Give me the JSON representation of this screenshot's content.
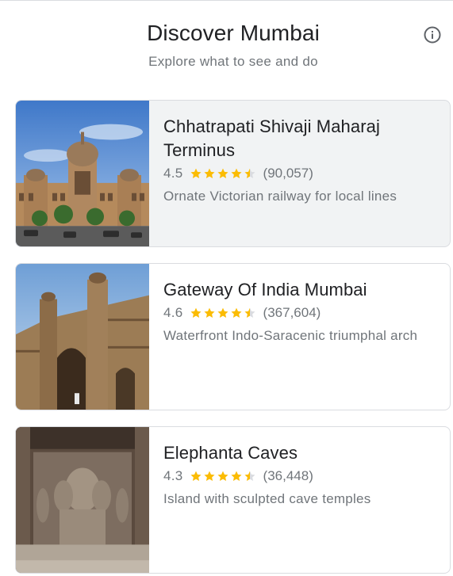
{
  "header": {
    "title": "Discover Mumbai",
    "subtitle": "Explore what to see and do",
    "info_icon": "info-icon"
  },
  "colors": {
    "star": "#fbbc04",
    "star_empty": "#dadce0",
    "text_primary": "#202124",
    "text_secondary": "#70757a",
    "card_border": "#dadce0",
    "card_highlight": "#f1f3f4"
  },
  "places": [
    {
      "name": "Chhatrapati Shivaji Maharaj Terminus",
      "rating": "4.5",
      "rating_value": 4.5,
      "reviews": "(90,057)",
      "description": "Ornate Victorian railway for local lines"
    },
    {
      "name": "Gateway Of India Mumbai",
      "rating": "4.6",
      "rating_value": 4.6,
      "reviews": "(367,604)",
      "description": "Waterfront Indo-Saracenic triumphal arch"
    },
    {
      "name": "Elephanta Caves",
      "rating": "4.3",
      "rating_value": 4.3,
      "reviews": "(36,448)",
      "description": "Island with sculpted cave temples"
    }
  ]
}
